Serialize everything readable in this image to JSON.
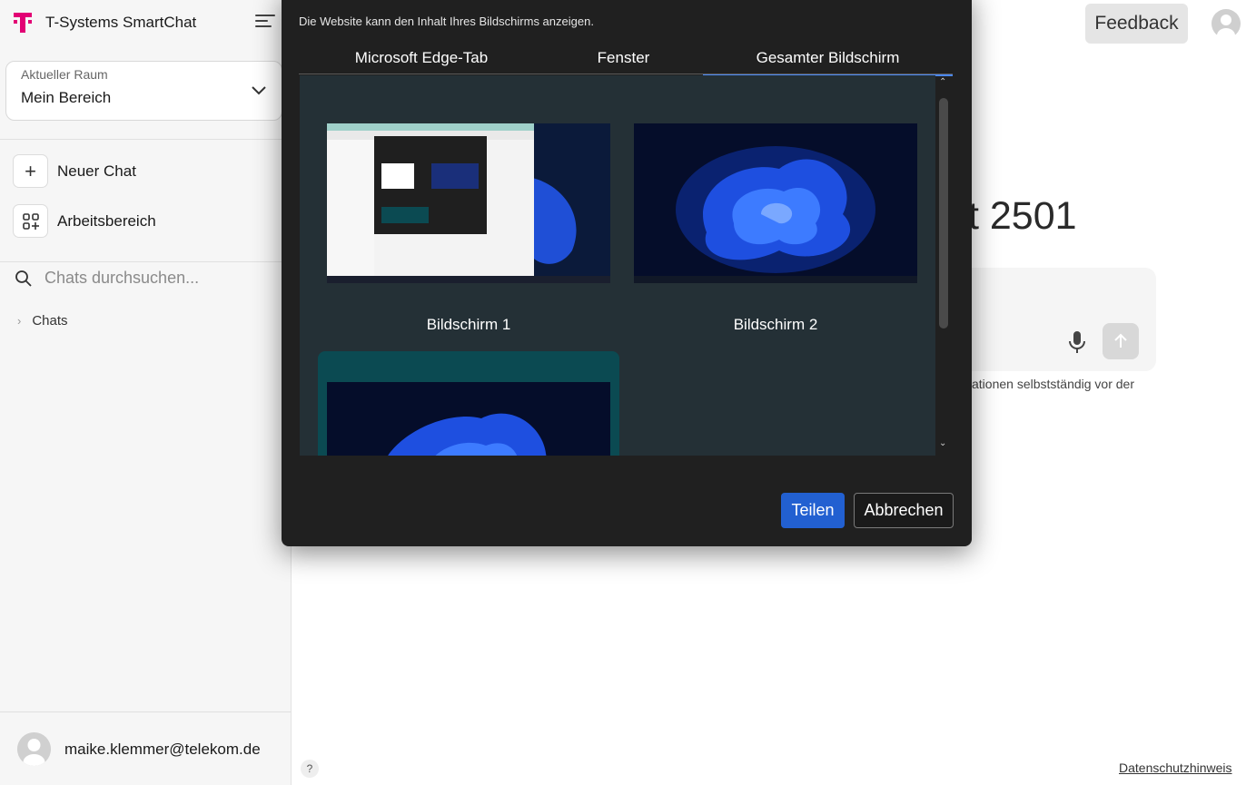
{
  "sidebar": {
    "app_title": "T-Systems SmartChat",
    "room_label": "Aktueller Raum",
    "room_value": "Mein Bereich",
    "new_chat": "Neuer Chat",
    "workspace": "Arbeitsbereich",
    "search_placeholder": "Chats durchsuchen...",
    "chats": "Chats",
    "user_email": "maike.klemmer@telekom.de"
  },
  "header": {
    "feedback": "Feedback"
  },
  "main": {
    "headline_fragment": "t 2501",
    "notice_fragment": "ationen selbstständig vor der",
    "help": "?",
    "privacy": "Datenschutzhinweis"
  },
  "dialog": {
    "message": "Die Website kann den Inhalt Ihres Bildschirms anzeigen.",
    "tabs": [
      "Microsoft Edge-Tab",
      "Fenster",
      "Gesamter Bildschirm"
    ],
    "active_tab": "Gesamter Bildschirm",
    "screens": [
      "Bildschirm 1",
      "Bildschirm 2"
    ],
    "share": "Teilen",
    "cancel": "Abbrechen"
  },
  "colors": {
    "brand_magenta": "#e20074",
    "dialog_bg": "#202020",
    "pane_bg": "#243036",
    "share_blue": "#2260d1",
    "selected_tile": "#0b4a52"
  }
}
